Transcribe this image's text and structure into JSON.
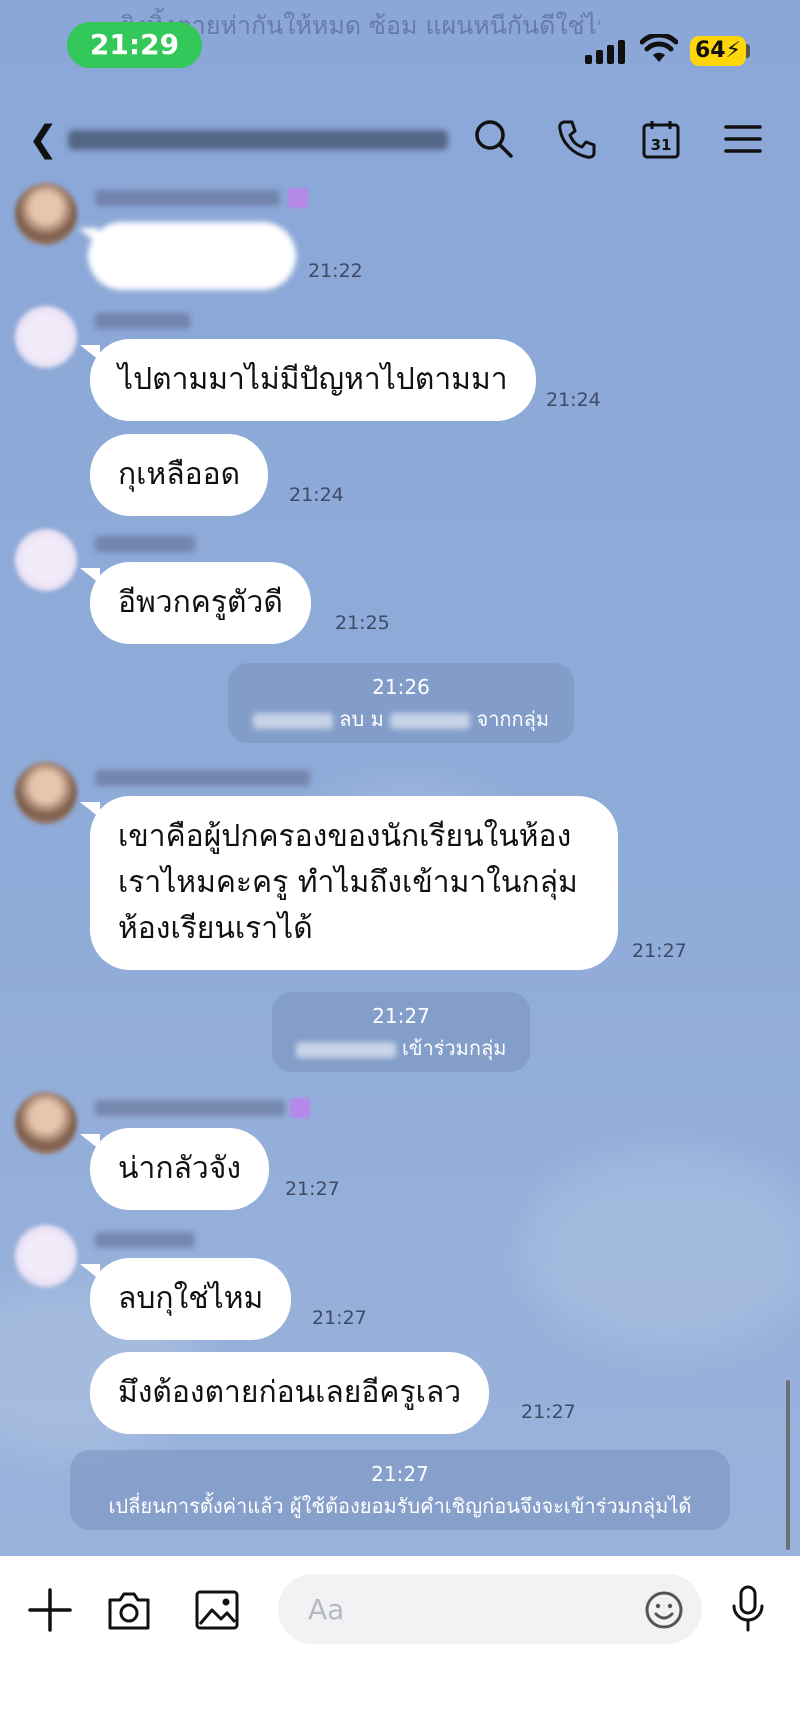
{
  "status_bar": {
    "time": "21:29",
    "battery": "64",
    "notification_text": "ยิงทิ้งตายห่ากันให้หมด ซ้อม แผนหนีกันดีใช่ไหม พรุ่งนี้เตรียมตัว"
  },
  "header": {
    "icons": [
      "back-icon",
      "search-icon",
      "phone-icon",
      "calendar-icon",
      "menu-icon"
    ],
    "calendar_day": "31"
  },
  "messages": [
    {
      "type": "incoming",
      "text": "",
      "time": "21:22",
      "blurred": true
    },
    {
      "type": "incoming",
      "text": "ไปตามมาไม่มีปัญหาไปตามมา",
      "time": "21:24"
    },
    {
      "type": "incoming",
      "text": "กุเหลืออด",
      "time": "21:24"
    },
    {
      "type": "incoming",
      "text": "อีพวกครูตัวดี",
      "time": "21:25"
    },
    {
      "type": "incoming",
      "text": "เขาคือผู้ปกครองของนักเรียนในห้อง เราไหมคะครู ทำไมถึงเข้ามาในกลุ่ม ห้องเรียนเราได้",
      "time": "21:27"
    },
    {
      "type": "incoming",
      "text": "น่ากลัวจัง",
      "time": "21:27"
    },
    {
      "type": "incoming",
      "text": "ลบกุใช่ไหม",
      "time": "21:27"
    },
    {
      "type": "incoming",
      "text": "มึงต้องตายก่อนเลยอีครูเลว",
      "time": "21:27"
    }
  ],
  "system_messages": [
    {
      "time": "21:26",
      "text_a": "ลบ ม",
      "text_b": "จากกลุ่ม"
    },
    {
      "time": "21:27",
      "text_b": "เข้าร่วมกลุ่ม"
    },
    {
      "time": "21:27",
      "text": "เปลี่ยนการตั้งค่าแล้ว ผู้ใช้ต้องยอมรับคำเชิญก่อนจึงจะเข้าร่วมกลุ่มได้"
    }
  ],
  "input": {
    "placeholder": "Aa",
    "icons": [
      "plus-icon",
      "camera-icon",
      "image-icon",
      "emoji-icon",
      "microphone-icon"
    ]
  },
  "colors": {
    "chat_background": "#8ea9d6",
    "time_pill": "#34c759",
    "battery": "#ffd60a",
    "bubble": "#ffffff"
  }
}
